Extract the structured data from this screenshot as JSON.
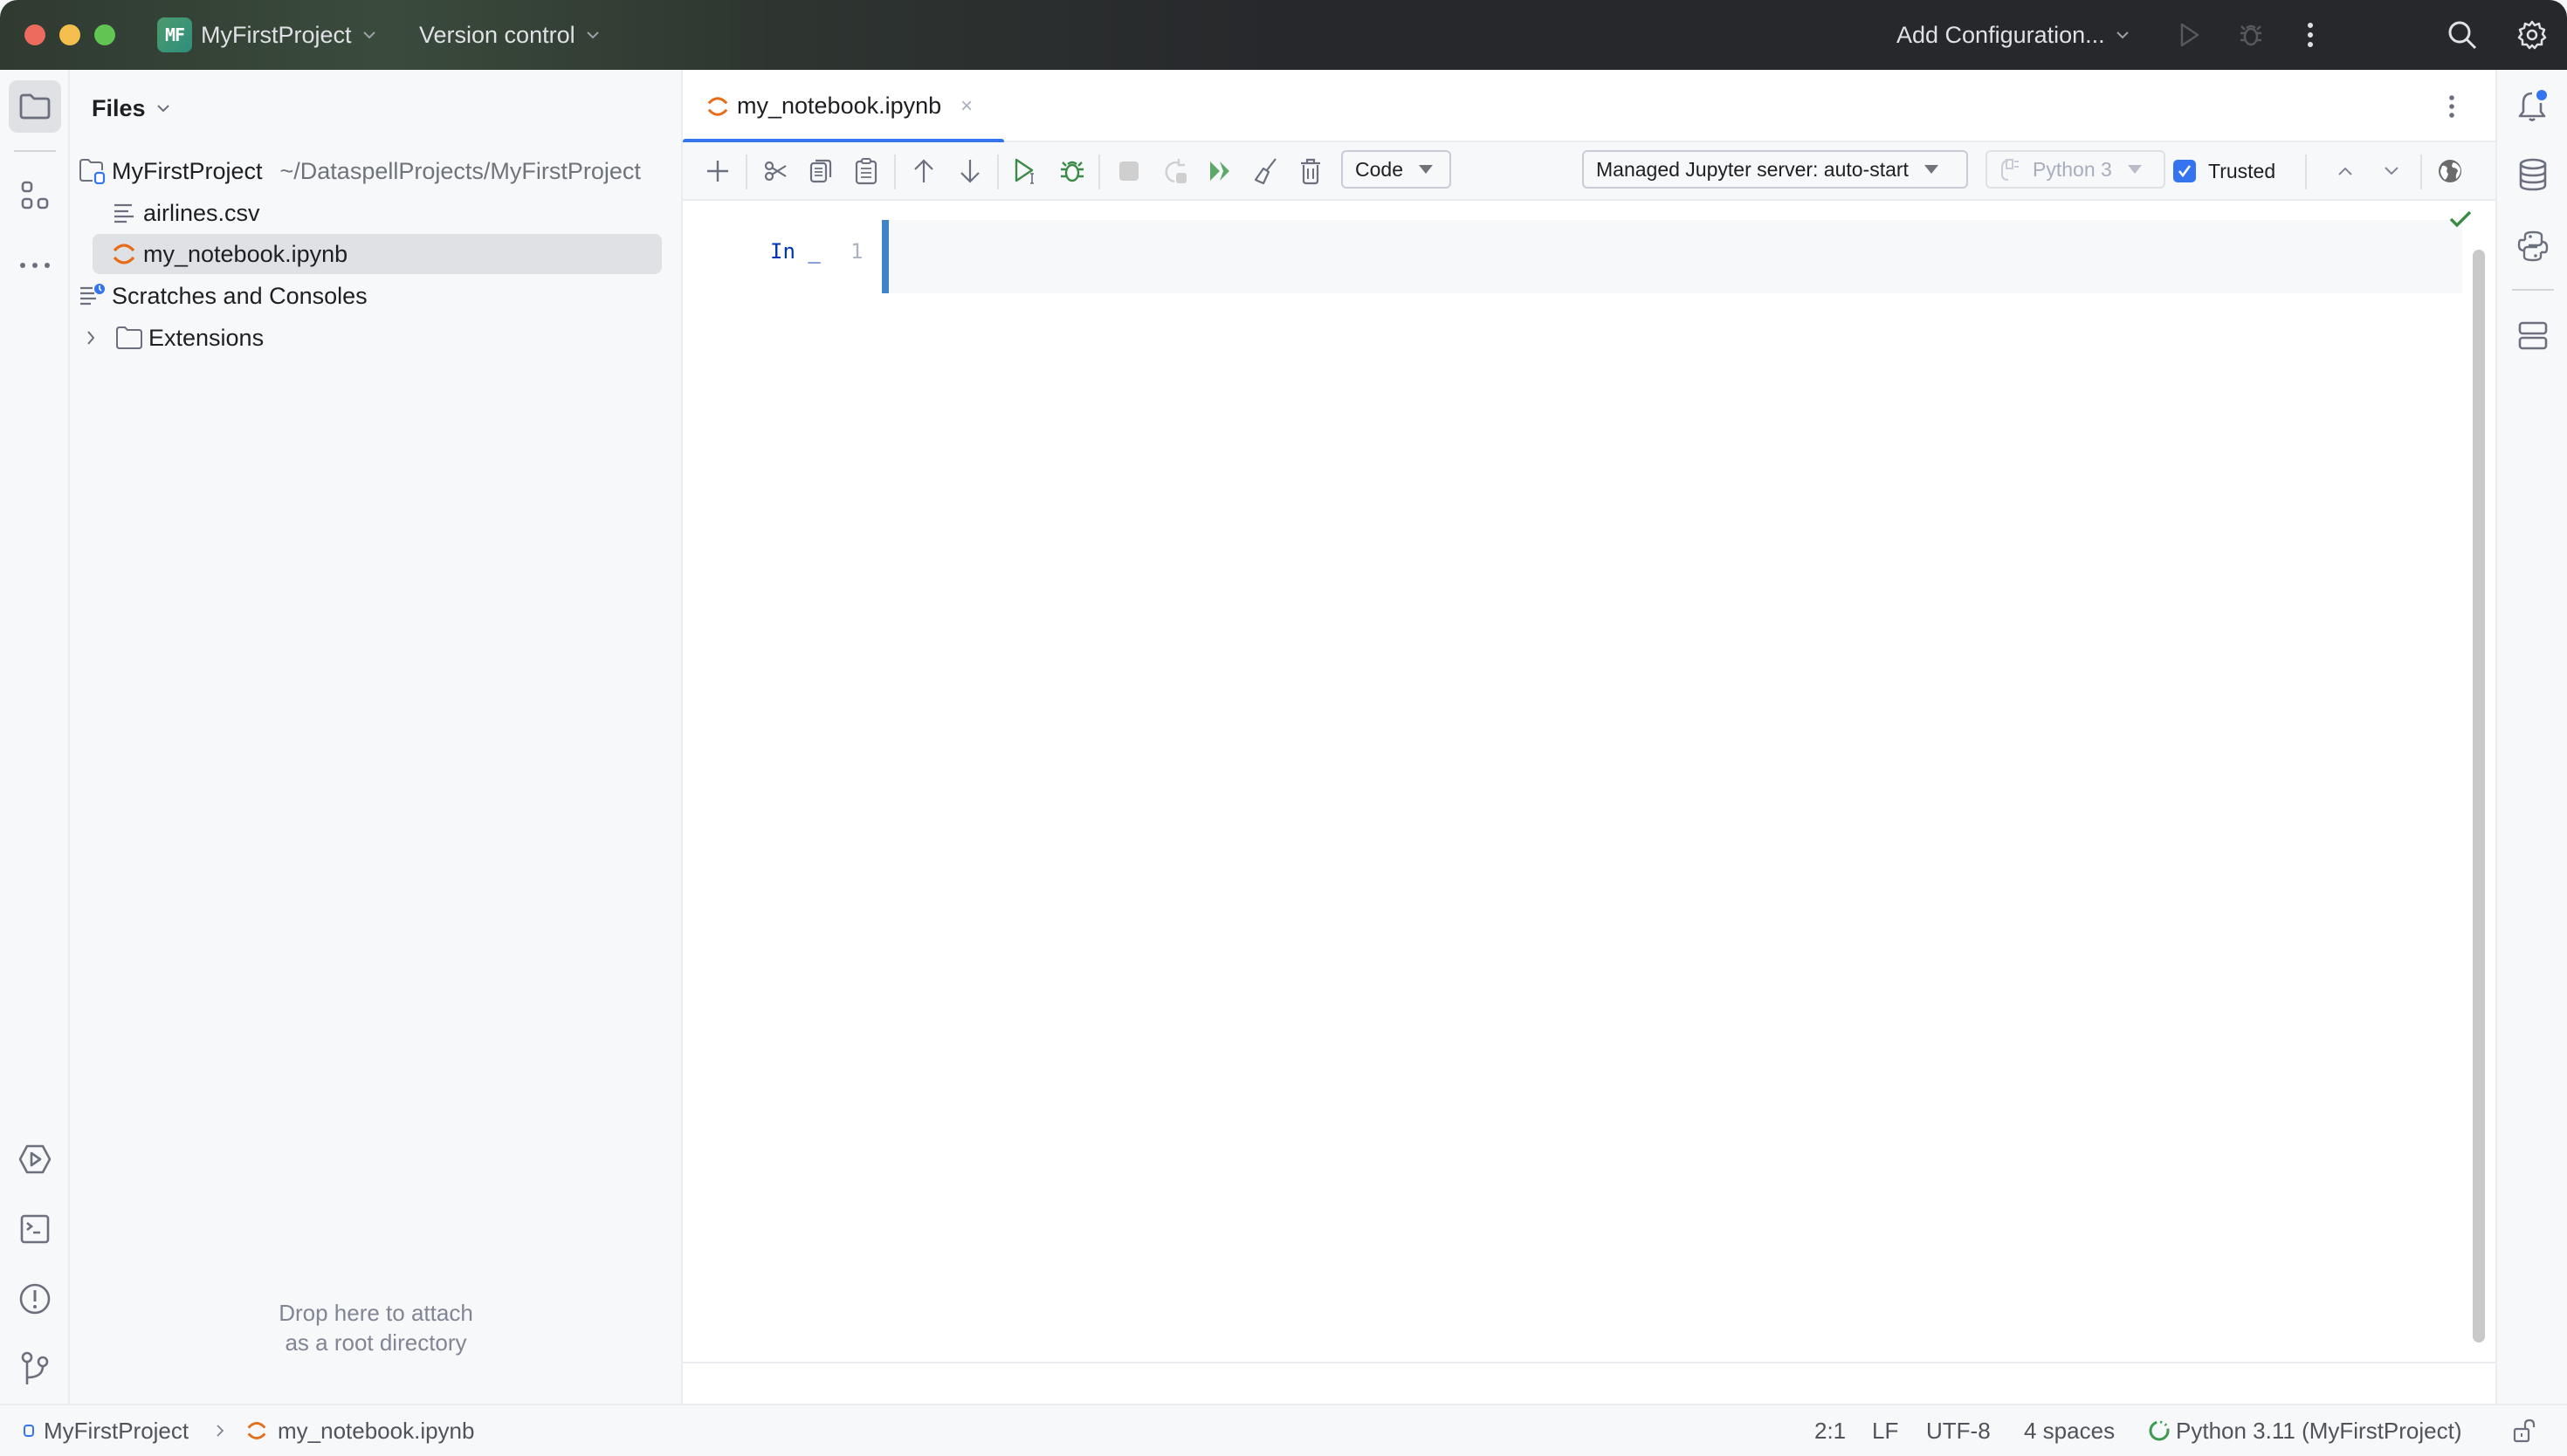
{
  "titlebar": {
    "project_badge": "MF",
    "project_name": "MyFirstProject",
    "version_control": "Version control",
    "run_config": "Add Configuration...",
    "icons": [
      "run-icon",
      "debug-icon",
      "more-vertical-icon",
      "search-icon",
      "settings-gear-icon"
    ]
  },
  "left_strip": {
    "top_items": [
      "project-folder-icon",
      "structure-icon",
      "more-horizontal-icon"
    ],
    "bottom_items": [
      "run-services-icon",
      "terminal-icon",
      "problems-icon",
      "git-branch-icon"
    ]
  },
  "files_panel": {
    "header": "Files",
    "tree": [
      {
        "label": "MyFirstProject",
        "path": "~/DataspellProjects/MyFirstProject",
        "icon": "project-folder-icon",
        "level": 0
      },
      {
        "label": "airlines.csv",
        "icon": "text-file-icon",
        "level": 1
      },
      {
        "label": "my_notebook.ipynb",
        "icon": "jupyter-icon",
        "level": 1,
        "selected": true
      },
      {
        "label": "Scratches and Consoles",
        "icon": "scratches-icon",
        "level": 0
      },
      {
        "label": "Extensions",
        "icon": "folder-icon",
        "level": 0,
        "collapsed": true
      }
    ],
    "drop_hint_line1": "Drop here to attach",
    "drop_hint_line2": "as a root directory"
  },
  "editor": {
    "tab": {
      "label": "my_notebook.ipynb",
      "close": "×"
    },
    "toolbar": {
      "cell_type": "Code",
      "server": "Managed Jupyter server: auto-start",
      "kernel": "Python 3",
      "trusted_label": "Trusted",
      "trusted_checked": true
    },
    "cell": {
      "prompt": "In _",
      "line_number": "1",
      "content": ""
    }
  },
  "right_strip": {
    "items": [
      "notifications-icon",
      "database-icon",
      "python-console-icon",
      "layout-icon"
    ],
    "notification_badge": true
  },
  "statusbar": {
    "breadcrumb": [
      "MyFirstProject",
      "my_notebook.ipynb"
    ],
    "position": "2:1",
    "line_separator": "LF",
    "encoding": "UTF-8",
    "indent": "4 spaces",
    "interpreter": "Python 3.11 (MyFirstProject)"
  },
  "colors": {
    "accent": "#3574f0",
    "jupyter_orange": "#e66d17",
    "run_green": "#3c8a47",
    "prompt_blue": "#0033b3"
  }
}
